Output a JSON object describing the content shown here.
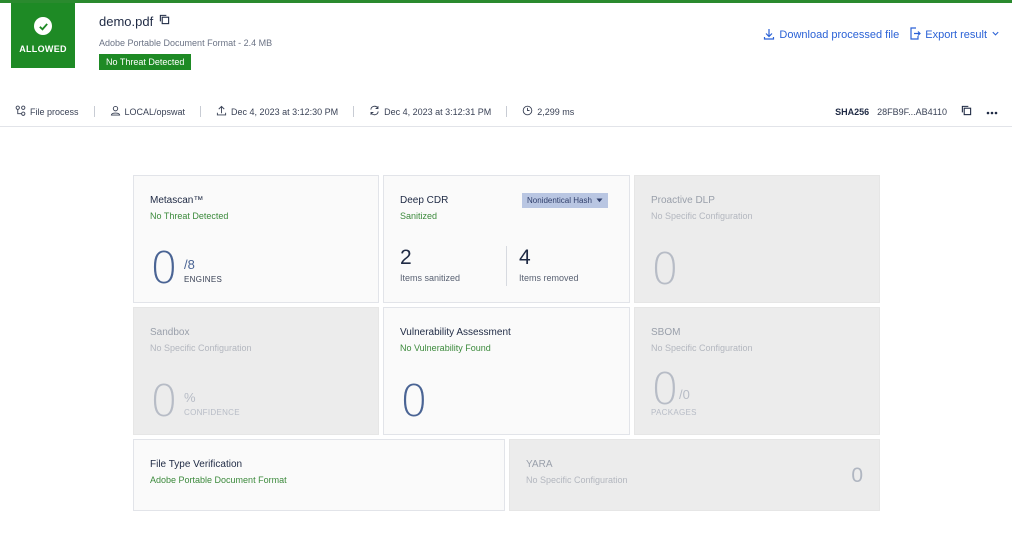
{
  "verdict": {
    "label": "ALLOWED"
  },
  "file": {
    "name": "demo.pdf",
    "subtitle": "Adobe Portable Document Format - 2.4 MB",
    "badge": "No Threat Detected"
  },
  "actions": {
    "download": "Download processed file",
    "export": "Export result"
  },
  "meta": {
    "process": "File process",
    "user": "LOCAL/opswat",
    "start": "Dec 4, 2023 at 3:12:30 PM",
    "end": "Dec 4, 2023 at 3:12:31 PM",
    "duration": "2,299 ms",
    "sha_label": "SHA256",
    "sha_value": "28FB9F...AB4110"
  },
  "cards": {
    "metascan": {
      "title": "Metascan™",
      "status": "No Threat Detected",
      "value": "0",
      "engines": "/8",
      "caption": "ENGINES"
    },
    "cdr": {
      "title": "Deep CDR",
      "status": "Sanitized",
      "dropdown": "Nonidentical Hash",
      "sanitized_value": "2",
      "sanitized_label": "Items sanitized",
      "removed_value": "4",
      "removed_label": "Items removed"
    },
    "dlp": {
      "title": "Proactive DLP",
      "status": "No Specific Configuration",
      "value": "0"
    },
    "sandbox": {
      "title": "Sandbox",
      "status": "No Specific Configuration",
      "value": "0",
      "unit": "%",
      "caption": "CONFIDENCE"
    },
    "vuln": {
      "title": "Vulnerability Assessment",
      "status": "No Vulnerability Found",
      "value": "0"
    },
    "sbom": {
      "title": "SBOM",
      "status": "No Specific Configuration",
      "value": "0",
      "unit": "/0",
      "caption": "PACKAGES"
    },
    "ftv": {
      "title": "File Type Verification",
      "status": "Adobe Portable Document Format"
    },
    "yara": {
      "title": "YARA",
      "status": "No Specific Configuration",
      "value": "0"
    }
  },
  "colors": {
    "allowed": "#1e8a25",
    "accent": "#2b62d6",
    "number": "#4a6494"
  }
}
